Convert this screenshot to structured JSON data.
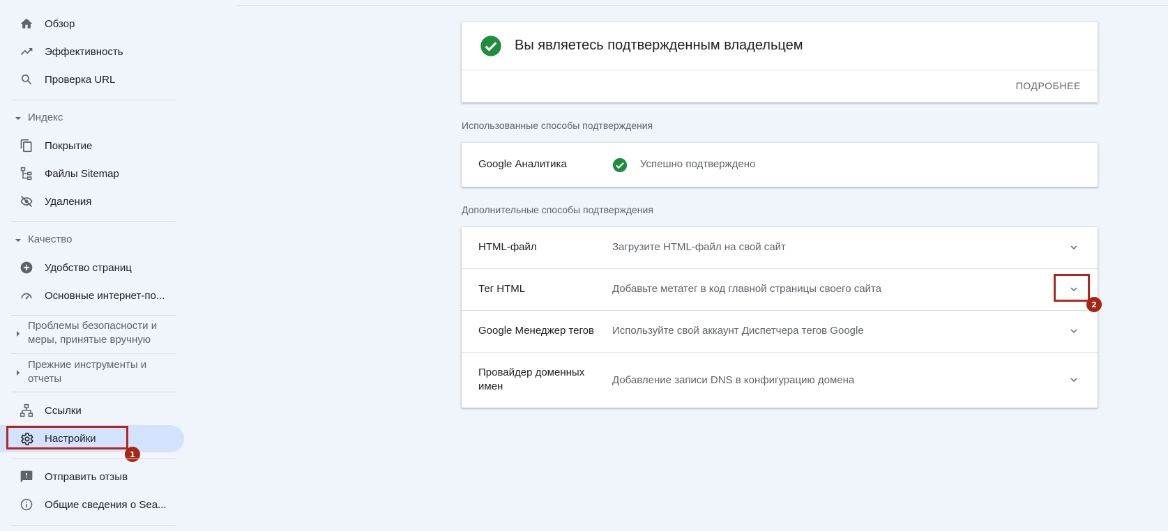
{
  "sidebar": {
    "items": [
      {
        "label": "Обзор",
        "icon": "home-icon"
      },
      {
        "label": "Эффективность",
        "icon": "trending-up-icon"
      },
      {
        "label": "Проверка URL",
        "icon": "search-icon"
      },
      {
        "label": "Покрытие",
        "icon": "copy-pages-icon"
      },
      {
        "label": "Файлы Sitemap",
        "icon": "sitemap-icon"
      },
      {
        "label": "Удаления",
        "icon": "visibility-off-icon"
      },
      {
        "label": "Удобство страниц",
        "icon": "plus-circle-icon"
      },
      {
        "label": "Основные интернет-по...",
        "icon": "speed-gauge-icon"
      },
      {
        "label": "Ссылки",
        "icon": "links-tree-icon"
      },
      {
        "label": "Настройки",
        "icon": "gear-icon"
      },
      {
        "label": "Отправить отзыв",
        "icon": "feedback-icon"
      },
      {
        "label": "Общие сведения о Sea...",
        "icon": "info-icon"
      }
    ],
    "sections": {
      "index": "Индекс",
      "quality": "Качество",
      "security_line1": "Проблемы безопасности и",
      "security_line2": "меры, принятые вручную",
      "legacy_line1": "Прежние инструменты и",
      "legacy_line2": "отчеты"
    },
    "active_item": "Настройки"
  },
  "annotations": {
    "badge1": "1",
    "badge2": "2"
  },
  "owner_card": {
    "title": "Вы являетесь подтвержденным владельцем",
    "more_button": "ПОДРОБНЕЕ"
  },
  "used_methods": {
    "label": "Использованные способы подтверждения",
    "items": [
      {
        "name": "Google Аналитика",
        "status": "Успешно подтверждено"
      }
    ]
  },
  "additional_methods": {
    "label": "Дополнительные способы подтверждения",
    "items": [
      {
        "name": "HTML-файл",
        "desc": "Загрузите HTML-файл на свой сайт"
      },
      {
        "name": "Тег HTML",
        "desc": "Добавьте метатег в код главной страницы своего сайта"
      },
      {
        "name": "Google Менеджер тегов",
        "desc": "Используйте свой аккаунт Диспетчера тегов Google"
      },
      {
        "name_line1": "Провайдер доменных",
        "name_line2": "имен",
        "desc": "Добавление записи DNS в конфигурацию домена"
      }
    ]
  },
  "colors": {
    "background": "#f0f4fb",
    "active_bg": "#d3e3fd",
    "success_green": "#1e8e3e",
    "annotation_red": "#b3261e"
  }
}
